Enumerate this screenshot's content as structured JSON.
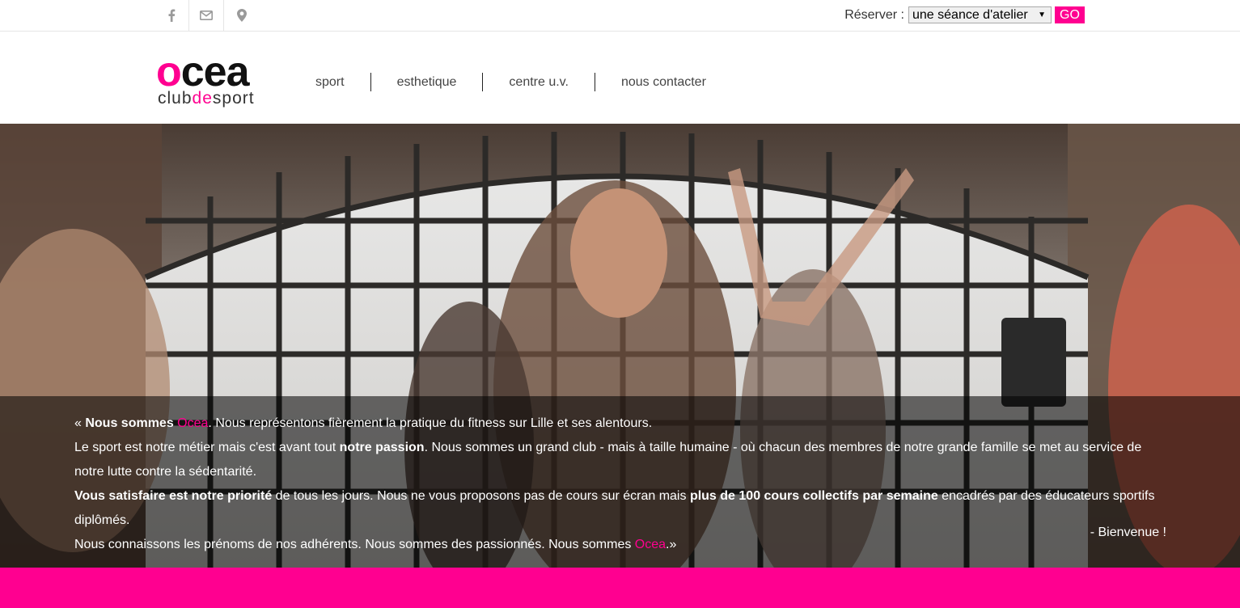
{
  "topbar": {
    "social_icons": [
      "facebook-icon",
      "mail-icon",
      "map-marker-icon"
    ],
    "reserve_label": "Réserver :",
    "reserve_selected": "une séance d'atelier",
    "go_label": "GO"
  },
  "logo": {
    "word_accent": "o",
    "word_rest": "cea",
    "sub_a": "club",
    "sub_b": "de",
    "sub_c": "sport"
  },
  "nav": [
    "sport",
    "esthetique",
    "centre u.v.",
    "nous contacter"
  ],
  "intro": {
    "l1_a": "« ",
    "l1_b": "Nous sommes",
    "l1_c": " ",
    "l1_brand": "Ocea",
    "l1_d": ". Nous représentons fièrement la pratique du fitness sur Lille et ses alentours.",
    "l2_a": "Le sport est notre métier mais c'est avant tout ",
    "l2_b": "notre passion",
    "l2_c": ". Nous sommes un grand club - mais à taille humaine - où chacun des membres de notre grande famille se met au service de notre lutte contre la sédentarité.",
    "l3_a": "Vous satisfaire est notre priorité",
    "l3_b": " de tous les jours. Nous ne vous proposons pas de cours sur écran mais ",
    "l3_c": "plus de 100 cours collectifs par semaine",
    "l3_d": " encadrés par des éducateurs sportifs diplômés.",
    "l4_a": "Nous connaissons les prénoms de nos adhérents. Nous sommes des passionnés. Nous sommes ",
    "l4_brand": "Ocea",
    "l4_b": ".»",
    "bienvenue": "- Bienvenue !"
  },
  "colors": {
    "brand_pink": "#ff0090"
  }
}
